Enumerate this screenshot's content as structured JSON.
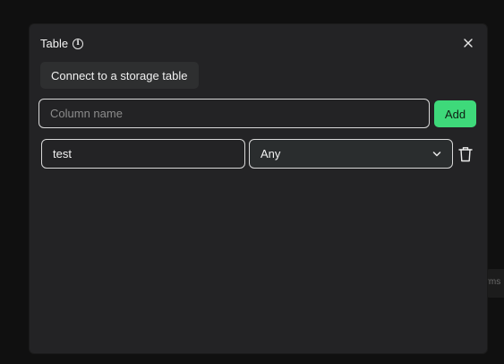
{
  "background": {
    "panel_text": "orms"
  },
  "dialog": {
    "title": "Table",
    "info_icon": "info-icon",
    "close_icon": "close-icon",
    "connect_label": "Connect to a storage table",
    "column_input": {
      "value": "",
      "placeholder": "Column name"
    },
    "add_label": "Add",
    "columns": [
      {
        "name": "test",
        "type": "Any"
      }
    ],
    "colors": {
      "dialog_bg": "#232325",
      "accent": "#3ed97a"
    }
  }
}
